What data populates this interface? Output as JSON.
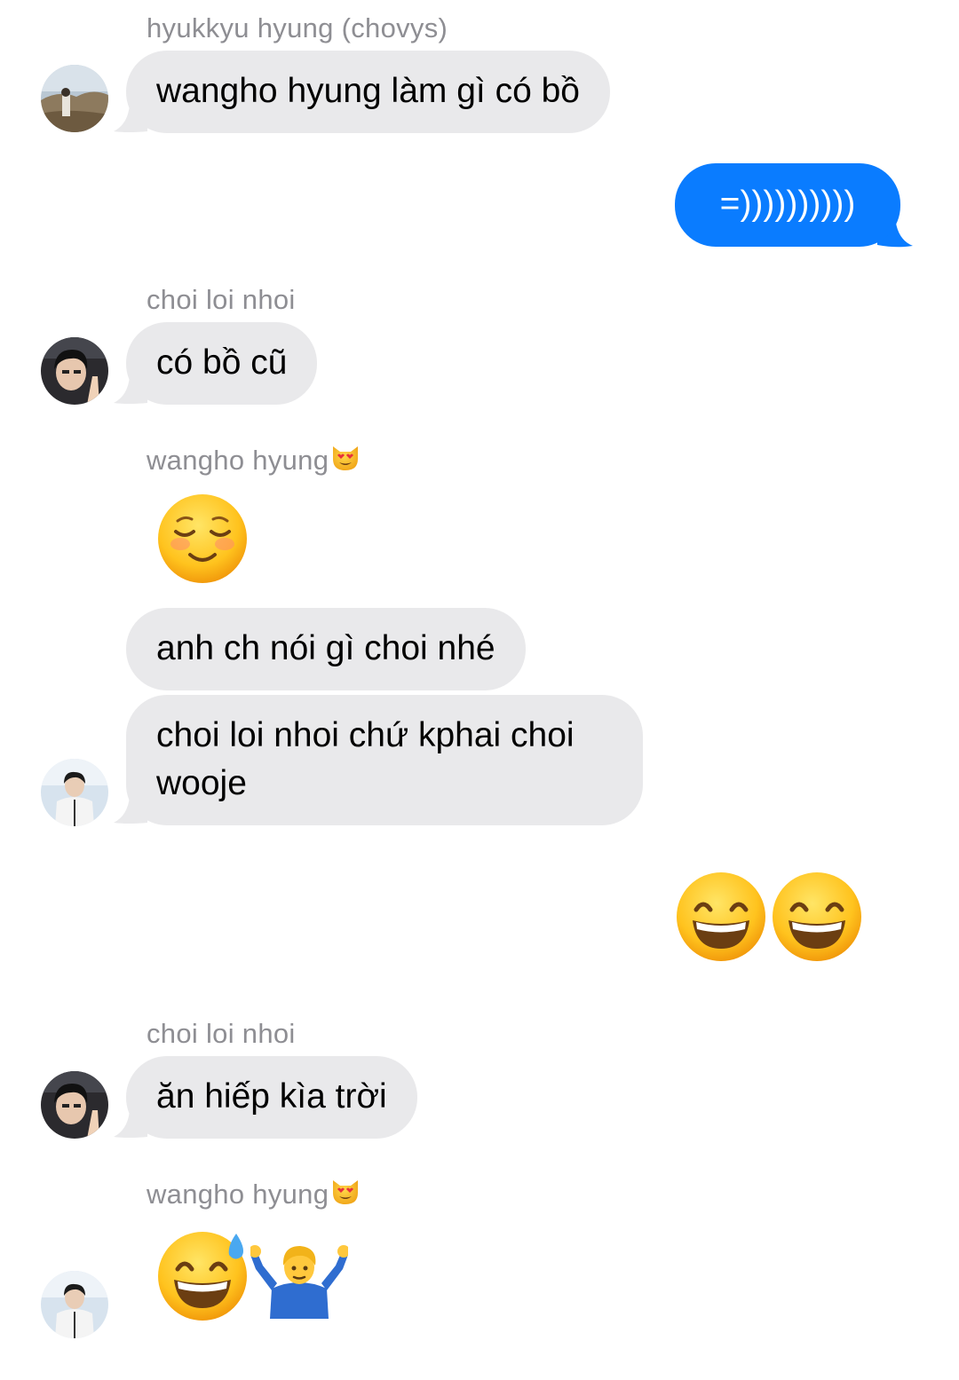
{
  "messages": [
    {
      "sender": "hyukkyu hyung (chovys)",
      "text": "wangho hyung làm gì có bồ",
      "avatar": "avatar-hyukkyu"
    },
    {
      "outgoing": true,
      "text": "=))))))))))"
    },
    {
      "sender": "choi loi nhoi",
      "text": "có bồ cũ",
      "avatar": "avatar-choi"
    },
    {
      "sender": "wangho hyung",
      "sender_emoji": "heart-eyes-cat-emoji",
      "emoji": "smiling-face-emoji"
    },
    {
      "text": "anh ch nói gì choi nhé"
    },
    {
      "text": "choi loi nhoi chứ kphai choi wooje",
      "avatar": "avatar-wangho"
    },
    {
      "outgoing": true,
      "emoji": [
        "grinning-face-emoji",
        "grinning-face-emoji"
      ]
    },
    {
      "sender": "choi loi nhoi",
      "text": "ăn hiếp kìa trời",
      "avatar": "avatar-choi"
    },
    {
      "sender": "wangho hyung",
      "sender_emoji": "heart-eyes-cat-emoji",
      "emoji": [
        "sweat-smile-emoji",
        "man-shrugging-emoji"
      ],
      "avatar": "avatar-wangho"
    }
  ],
  "colors": {
    "incoming_bubble": "#e9e9eb",
    "outgoing_bubble": "#0a7cff",
    "sender_label": "#8e8e93"
  }
}
